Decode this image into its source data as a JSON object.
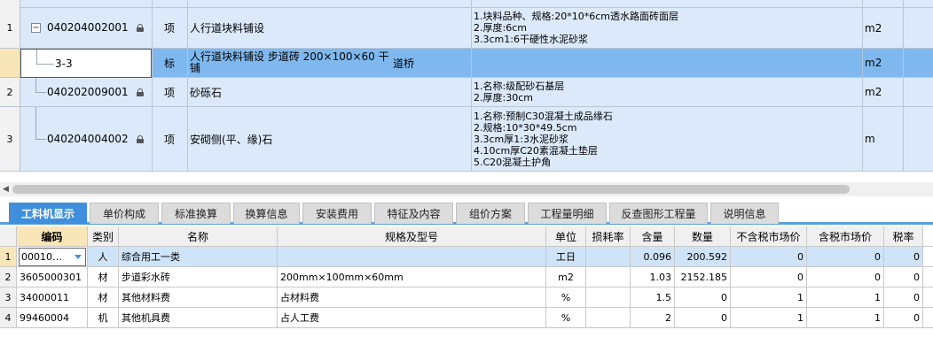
{
  "upper_rows": [
    {
      "num": "1",
      "code": "040204002001",
      "type": "项",
      "name": "人行道块料铺设",
      "spec": [
        "1.块料品种、规格:20*10*6cm透水路面砖面层",
        "2.厚度:6cm",
        "3.3cm1:6干硬性水泥砂浆"
      ],
      "unit": "m2"
    },
    {
      "num": "",
      "code": "3-3",
      "type": "标",
      "name": "人行道块料铺设 步道砖 200×100×60 干铺",
      "extra": "道桥",
      "spec": [],
      "unit": "m2"
    },
    {
      "num": "2",
      "code": "040202009001",
      "type": "项",
      "name": "砂砾石",
      "spec": [
        "1.名称:级配砂石基层",
        "2.厚度:30cm"
      ],
      "unit": "m2"
    },
    {
      "num": "3",
      "code": "040204004002",
      "type": "项",
      "name": "安砌侧(平、缘)石",
      "spec": [
        "1.名称:预制C30混凝土成品缘石",
        "2.规格:10*30*49.5cm",
        "3.3cm厚1:3水泥砂浆",
        "4.10cm厚C20素混凝土垫层",
        "5.C20混凝土护角"
      ],
      "unit": "m"
    }
  ],
  "tabs": [
    "工料机显示",
    "单价构成",
    "标准换算",
    "换算信息",
    "安装费用",
    "特征及内容",
    "组价方案",
    "工程量明细",
    "反查图形工程量",
    "说明信息"
  ],
  "grid": {
    "headers": [
      "编码",
      "类别",
      "名称",
      "规格及型号",
      "单位",
      "损耗率",
      "含量",
      "数量",
      "不含税市场价",
      "含税市场价",
      "税率"
    ],
    "rows": [
      {
        "num": "1",
        "code": "00010…",
        "cat": "人",
        "name": "综合用工一类",
        "spec": "",
        "unit": "工日",
        "loss": "",
        "content": "0.096",
        "qty": "200.592",
        "price_ex": "0",
        "price_in": "0",
        "tax": "0"
      },
      {
        "num": "2",
        "code": "3605000301",
        "cat": "材",
        "name": "步道彩水砖",
        "spec": "200mm×100mm×60mm",
        "unit": "m2",
        "loss": "",
        "content": "1.03",
        "qty": "2152.185",
        "price_ex": "0",
        "price_in": "0",
        "tax": "0"
      },
      {
        "num": "3",
        "code": "34000011",
        "cat": "材",
        "name": "其他材料费",
        "spec": "占材料费",
        "unit": "%",
        "loss": "",
        "content": "1.5",
        "qty": "0",
        "price_ex": "1",
        "price_in": "1",
        "tax": "0"
      },
      {
        "num": "4",
        "code": "99460004",
        "cat": "机",
        "name": "其他机具费",
        "spec": "占人工费",
        "unit": "%",
        "loss": "",
        "content": "2",
        "qty": "0",
        "price_ex": "1",
        "price_in": "1",
        "tax": "0"
      }
    ]
  },
  "colors": {
    "accent": "#3f8fdc",
    "row_blue": "#dbe9fb",
    "selected_row": "#7fb8ee",
    "header_code": "#f9e6b8"
  },
  "icons": {
    "lock": "lock-icon",
    "collapse": "collapse-icon",
    "dropdown": "chevron-down-icon",
    "scroll_left": "chevron-left-icon"
  }
}
